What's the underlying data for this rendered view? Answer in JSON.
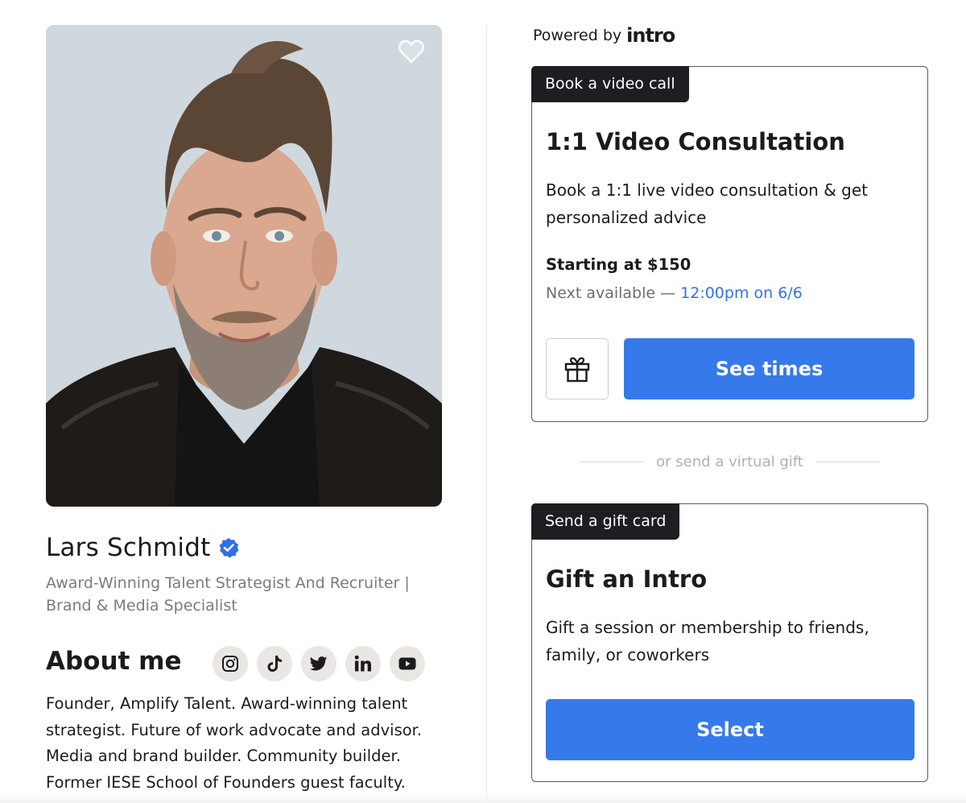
{
  "profile": {
    "name": "Lars Schmidt",
    "tagline": "Award-Winning Talent Strategist And Recruiter | Brand & Media Specialist",
    "about_title": "About me",
    "bio": "Founder, Amplify Talent. Award-winning talent strategist. Future of work advocate and advisor. Media and brand builder. Community builder. Former IESE School of Founders guest faculty.",
    "photo_icon": "profile-photo",
    "verified_icon": "verified-badge-icon",
    "favorite_icon": "heart-icon",
    "socials": [
      {
        "name": "instagram",
        "icon": "instagram-icon"
      },
      {
        "name": "tiktok",
        "icon": "tiktok-icon"
      },
      {
        "name": "twitter",
        "icon": "twitter-icon"
      },
      {
        "name": "linkedin",
        "icon": "linkedin-icon"
      },
      {
        "name": "youtube",
        "icon": "youtube-icon"
      }
    ]
  },
  "powered": {
    "label": "Powered by",
    "brand": "intro"
  },
  "video_card": {
    "tag": "Book a video call",
    "title": "1:1 Video Consultation",
    "description": "Book a 1:1 live video consultation & get personalized advice",
    "price": "Starting at $150",
    "next_label": "Next available — ",
    "next_slot": "12:00pm on 6/6",
    "gift_icon": "gift-icon",
    "button": "See times"
  },
  "separator": {
    "text": "or send a virtual gift"
  },
  "gift_card": {
    "tag": "Send a gift card",
    "title": "Gift an Intro",
    "description": "Gift a session or membership to friends, family, or coworkers",
    "button": "Select"
  },
  "colors": {
    "primary": "#3679ea",
    "tag_bg": "#1d1d22",
    "link": "#3572e0",
    "muted": "#7b7b7f",
    "verified": "#2f6ee8"
  }
}
